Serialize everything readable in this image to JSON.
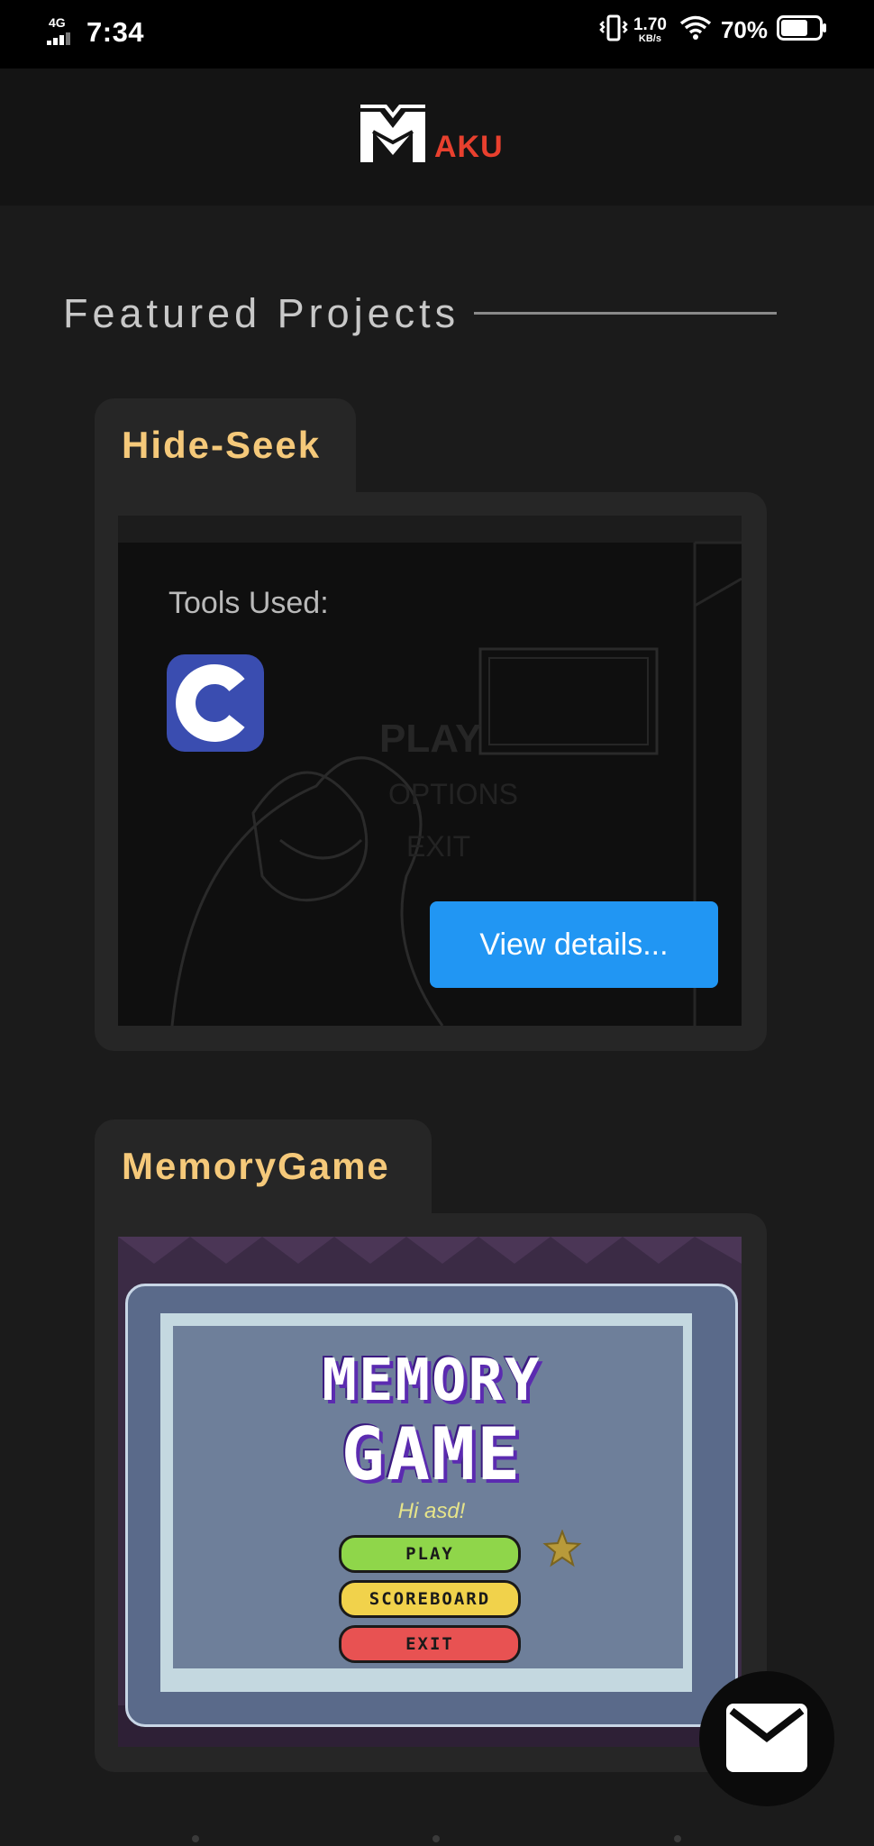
{
  "status_bar": {
    "network": "4G",
    "time": "7:34",
    "speed_value": "1.70",
    "speed_unit": "KB/s",
    "battery_percent": "70%",
    "battery_level": 0.7
  },
  "header": {
    "logo_text": "AKU"
  },
  "section": {
    "title": "Featured Projects"
  },
  "projects": [
    {
      "title": "Hide-Seek",
      "tools_label": "Tools Used:",
      "tools": [
        "c-language-icon"
      ],
      "button_label": "View details..."
    },
    {
      "title": "MemoryGame",
      "preview": {
        "title_line1": "MEMORY",
        "title_line2": "GAME",
        "greeting": "Hi asd!",
        "buttons": [
          "PLAY",
          "SCOREBOARD",
          "EXIT"
        ]
      }
    }
  ],
  "colors": {
    "accent_red": "#e8402e",
    "project_title": "#f5c97a",
    "button_blue": "#2196f3",
    "card_bg": "#262626",
    "page_bg": "#1b1b1b"
  },
  "icons": [
    "signal-icon",
    "vibrate-icon",
    "wifi-icon",
    "battery-icon",
    "logo-m-icon",
    "c-language-icon",
    "star-icon",
    "mail-icon"
  ]
}
